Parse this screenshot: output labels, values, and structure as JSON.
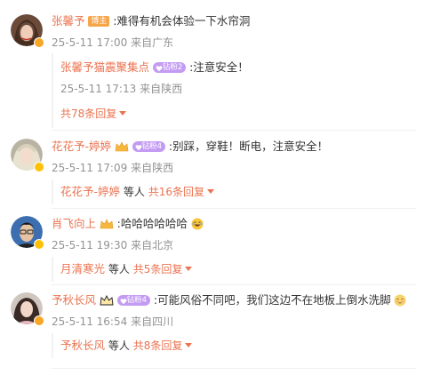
{
  "comments": [
    {
      "username": "张馨予",
      "tag": "博主",
      "text": ":难得有机会体验一下水帘洞",
      "time": "25-5-11 17:00",
      "location": "来自广东",
      "reply": {
        "username": "张馨予猫震聚集点",
        "fan_level": "钻粉2",
        "text": ":注意安全！",
        "time": "25-5-11 17:13",
        "location": "来自陕西"
      },
      "more_label": "共78条回复"
    },
    {
      "username": "花花予-婷婷",
      "fan_level": "钻粉4",
      "text": ":别踩，穿鞋！断电，注意安全！",
      "time": "25-5-11 17:09",
      "location": "来自陕西",
      "summary_user": "花花予-婷婷",
      "summary_mid": "等人",
      "more_label": "共16条回复"
    },
    {
      "username": "肖飞向上",
      "text": ":哈哈哈哈哈哈",
      "time": "25-5-11 19:30",
      "location": "来自北京",
      "summary_user": "月清寒光",
      "summary_mid": "等人",
      "more_label": "共5条回复"
    },
    {
      "username": "予秋长风",
      "fan_level": "钻粉4",
      "text": ":可能风俗不同吧，我们这边不在地板上倒水洗脚",
      "time": "25-5-11 16:54",
      "location": "来自四川",
      "summary_user": "予秋长风",
      "summary_mid": "等人",
      "more_label": "共8条回复"
    }
  ],
  "colors": {
    "username": "#eb7350",
    "meta": "#939393",
    "blogger_tag": "#f7a54a",
    "fan_badge": "#c39bf3",
    "verified_orange": "#f8a623",
    "verified_yellow": "#ffc107"
  },
  "icons": [
    "verified-badge-icon",
    "crown-icon",
    "laugh-emoji-icon",
    "shy-emoji-icon",
    "chevron-down-icon"
  ]
}
